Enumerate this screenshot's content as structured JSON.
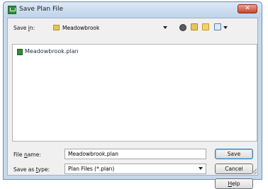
{
  "window": {
    "title": "Save Plan File",
    "close_glyph": "✕"
  },
  "save_in": {
    "label_pre": "Save ",
    "label_accel": "i",
    "label_post": "n:",
    "folder": "Meadowbrook"
  },
  "toolbar": {
    "icons": [
      "back-icon",
      "up-folder-icon",
      "new-folder-icon",
      "view-menu-icon"
    ]
  },
  "files": [
    {
      "name": "Meadowbrook.plan",
      "icon": "plan-file-icon"
    }
  ],
  "file_name": {
    "label_pre": "File ",
    "label_accel": "n",
    "label_post": "ame:",
    "value": "Meadowbrook.plan"
  },
  "save_as_type": {
    "label_pre": "Save as ",
    "label_accel": "t",
    "label_post": "ype:",
    "value": "Plan Files (*.plan)"
  },
  "buttons": {
    "save": "Save",
    "cancel": "Cancel",
    "help_accel": "H",
    "help_rest": "elp"
  },
  "colors": {
    "accent": "#3c7fb1",
    "close": "#c8452d",
    "app_icon": "#2f8f3a"
  }
}
